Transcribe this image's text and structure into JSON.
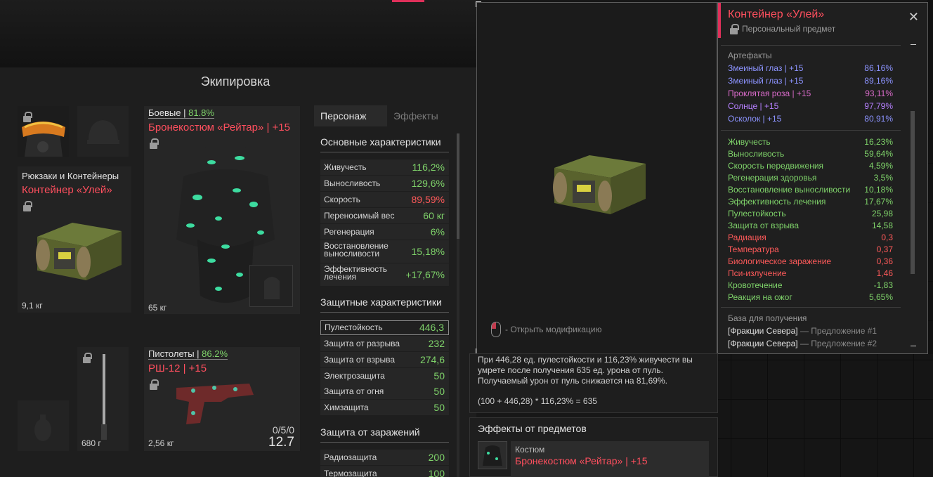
{
  "equipment": {
    "title": "Экипировка",
    "armor": {
      "category": "Боевые",
      "percent": "81.8%",
      "name": "Бронекостюм «Рейтар» | +15",
      "weight": "65 кг"
    },
    "container": {
      "category": "Рюкзаки и Контейнеры",
      "name": "Контейнер «Улей»",
      "weight": "9,1 кг"
    },
    "pistol": {
      "category": "Пистолеты",
      "percent": "86.2%",
      "name": "РШ-12 | +15",
      "ammo": "0/5/0",
      "caliber": "12.7",
      "weight": "2,56 кг"
    },
    "melee": {
      "weight": "680 г"
    }
  },
  "tabs": {
    "character": "Персонаж",
    "effects": "Эффекты"
  },
  "stats": {
    "main_title": "Основные характеристики",
    "main": [
      {
        "name": "Живучесть",
        "value": "116,2%"
      },
      {
        "name": "Выносливость",
        "value": "129,6%"
      },
      {
        "name": "Скорость",
        "value": "89,59%"
      },
      {
        "name": "Переносимый вес",
        "value": "60 кг"
      },
      {
        "name": "Регенерация",
        "value": "6%"
      },
      {
        "name": "Восстановление выносливости",
        "value": "15,18%"
      },
      {
        "name": "Эффективность лечения",
        "value": "+17,67%"
      }
    ],
    "defense_title": "Защитные характеристики",
    "defense": [
      {
        "name": "Пулестойкость",
        "value": "446,3"
      },
      {
        "name": "Защита от разрыва",
        "value": "232"
      },
      {
        "name": "Защита от взрыва",
        "value": "274,6"
      },
      {
        "name": "Электрозащита",
        "value": "50"
      },
      {
        "name": "Защита от огня",
        "value": "50"
      },
      {
        "name": "Химзащита",
        "value": "50"
      }
    ],
    "infect_title": "Защита от заражений",
    "infect": [
      {
        "name": "Радиозащита",
        "value": "200"
      },
      {
        "name": "Термозащита",
        "value": "100"
      }
    ]
  },
  "preview": {
    "mod_hint": "- Открыть модификацию"
  },
  "info": {
    "title": "Контейнер «Улей»",
    "subtitle": "Персональный предмет",
    "close": "✕",
    "artifacts_title": "Артефакты",
    "artifacts": [
      {
        "name": "Змеиный глаз | +15",
        "value": "86,16%"
      },
      {
        "name": "Змеиный глаз | +15",
        "value": "89,16%"
      },
      {
        "name": "Проклятая роза | +15",
        "value": "93,11%"
      },
      {
        "name": "Солнце | +15",
        "value": "97,79%"
      },
      {
        "name": "Осколок | +15",
        "value": "80,91%"
      }
    ],
    "bonuses": [
      {
        "name": "Живучесть",
        "value": "16,23%"
      },
      {
        "name": "Выносливость",
        "value": "59,64%"
      },
      {
        "name": "Скорость передвижения",
        "value": "4,59%"
      },
      {
        "name": "Регенерация здоровья",
        "value": "3,5%"
      },
      {
        "name": "Восстановление выносливости",
        "value": "10,18%"
      },
      {
        "name": "Эффективность лечения",
        "value": "17,67%"
      },
      {
        "name": "Пулестойкость",
        "value": "25,98"
      },
      {
        "name": "Защита от взрыва",
        "value": "14,58"
      },
      {
        "name": "Радиация",
        "value": "0,3"
      },
      {
        "name": "Температура",
        "value": "0,37"
      },
      {
        "name": "Биологическое заражение",
        "value": "0,36"
      },
      {
        "name": "Пси-излучение",
        "value": "1,46"
      },
      {
        "name": "Кровотечение",
        "value": "-1,83"
      },
      {
        "name": "Реакция на ожог",
        "value": "5,65%"
      }
    ],
    "source_title": "База для получения",
    "sources": [
      {
        "faction": "[Фракции Севера]",
        "offer": "— Предложение #1"
      },
      {
        "faction": "[Фракции Севера]",
        "offer": "— Предложение #2"
      }
    ]
  },
  "calc": {
    "line1": "При 446,28 ед. пулестойкости и 116,23% живучести вы",
    "line2": "умрете после получения 635 ед. урона от пуль.",
    "line3": "Получаемый урон от пуль снижается на 81,69%.",
    "formula": "(100 + 446,28) * 116,23% = 635"
  },
  "effects": {
    "title": "Эффекты от предметов",
    "category": "Костюм",
    "item": "Бронекостюм «Рейтар» | +15"
  },
  "colors": {
    "accent": "#e0305a",
    "red": "#ff4f5e",
    "green": "#7fd36a",
    "blue": "#8c93ff"
  }
}
